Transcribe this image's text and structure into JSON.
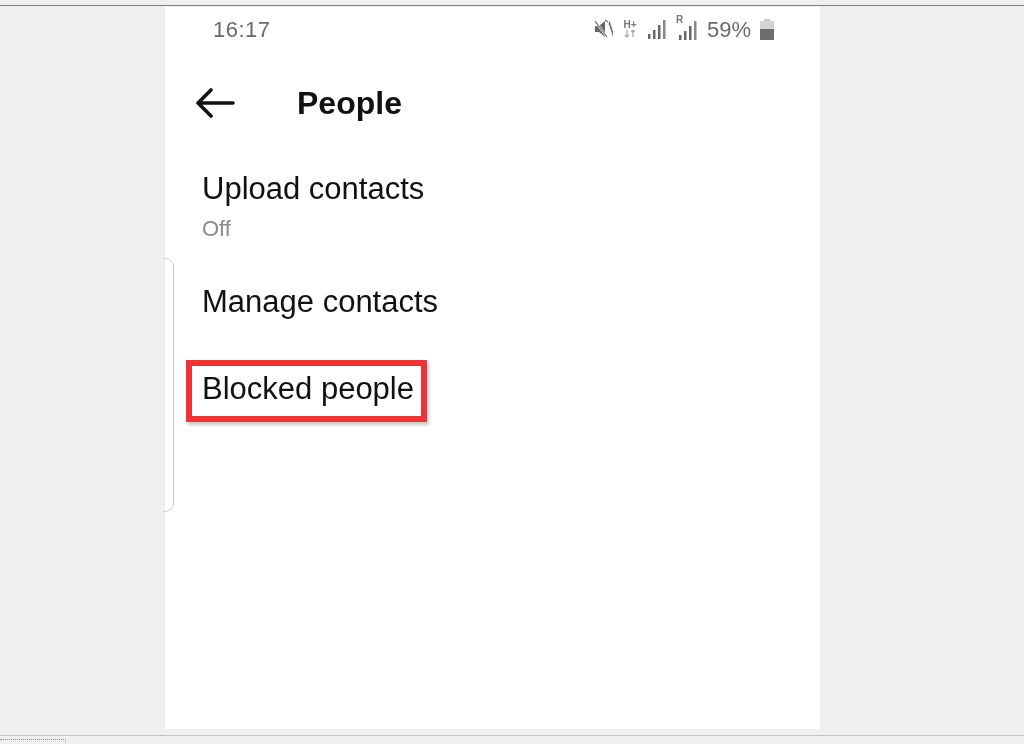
{
  "status_bar": {
    "time": "16:17",
    "network_type": "H+",
    "roaming": "R",
    "battery": "59%"
  },
  "header": {
    "title": "People"
  },
  "settings": [
    {
      "label": "Upload contacts",
      "value": "Off",
      "highlighted": false
    },
    {
      "label": "Manage contacts",
      "highlighted": false
    },
    {
      "label": "Blocked people",
      "highlighted": true
    }
  ]
}
